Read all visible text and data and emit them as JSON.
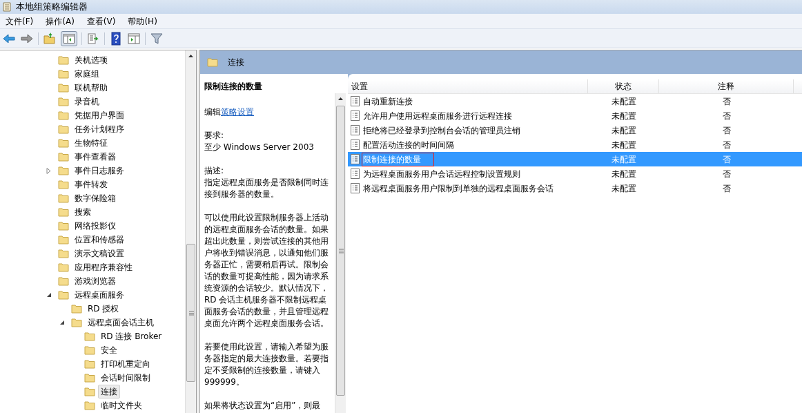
{
  "window": {
    "title": "本地组策略编辑器"
  },
  "menu": [
    "文件(F)",
    "操作(A)",
    "查看(V)",
    "帮助(H)"
  ],
  "tree": [
    {
      "label": "关机选项",
      "kind": "leaf",
      "selected": false
    },
    {
      "label": "家庭组",
      "kind": "leaf",
      "selected": false
    },
    {
      "label": "联机帮助",
      "kind": "leaf",
      "selected": false
    },
    {
      "label": "录音机",
      "kind": "leaf",
      "selected": false
    },
    {
      "label": "凭据用户界面",
      "kind": "leaf",
      "selected": false
    },
    {
      "label": "任务计划程序",
      "kind": "leaf",
      "selected": false
    },
    {
      "label": "生物特征",
      "kind": "leaf",
      "selected": false
    },
    {
      "label": "事件查看器",
      "kind": "leaf",
      "selected": false
    },
    {
      "label": "事件日志服务",
      "kind": "collapsed",
      "selected": false
    },
    {
      "label": "事件转发",
      "kind": "leaf",
      "selected": false
    },
    {
      "label": "数字保险箱",
      "kind": "leaf",
      "selected": false
    },
    {
      "label": "搜索",
      "kind": "leaf",
      "selected": false
    },
    {
      "label": "网络投影仪",
      "kind": "leaf",
      "selected": false
    },
    {
      "label": "位置和传感器",
      "kind": "leaf",
      "selected": false
    },
    {
      "label": "演示文稿设置",
      "kind": "leaf",
      "selected": false
    },
    {
      "label": "应用程序兼容性",
      "kind": "leaf",
      "selected": false
    },
    {
      "label": "游戏浏览器",
      "kind": "leaf",
      "selected": false
    },
    {
      "label": "远程桌面服务",
      "kind": "expanded",
      "selected": false,
      "children": [
        {
          "label": "RD 授权",
          "kind": "leaf",
          "selected": false
        },
        {
          "label": "远程桌面会话主机",
          "kind": "expanded",
          "selected": false,
          "children": [
            {
              "label": "RD 连接 Broker",
              "kind": "leaf",
              "selected": false
            },
            {
              "label": "安全",
              "kind": "leaf",
              "selected": false
            },
            {
              "label": "打印机重定向",
              "kind": "leaf",
              "selected": false
            },
            {
              "label": "会话时间限制",
              "kind": "leaf",
              "selected": false
            },
            {
              "label": "连接",
              "kind": "leaf",
              "selected": true
            },
            {
              "label": "临时文件夹",
              "kind": "leaf",
              "selected": false
            }
          ]
        }
      ]
    }
  ],
  "header": {
    "title": "连接"
  },
  "description": {
    "title": "限制连接的数量",
    "edit_prefix": "编辑",
    "edit_link": "策略设置",
    "requirements_label": "要求:",
    "requirements": "至少 Windows Server 2003",
    "description_label": "描述:",
    "paragraphs": [
      "指定远程桌面服务是否限制同时连接到服务器的数量。",
      "可以使用此设置限制服务器上活动的远程桌面服务会话的数量。如果超出此数量，则尝试连接的其他用户将收到错误消息，以通知他们服务器正忙，需要稍后再试。限制会话的数量可提高性能，因为请求系统资源的会话较少。默认情况下，RD 会话主机服务器不限制远程桌面服务会话的数量，并且管理远程桌面允许两个远程桌面服务会话。",
      "若要使用此设置，请输入希望为服务器指定的最大连接数量。若要指定不受限制的连接数量，请键入 999999。",
      "如果将状态设置为“启用”，则最"
    ]
  },
  "table": {
    "columns": [
      "设置",
      "状态",
      "注释"
    ],
    "rows": [
      {
        "setting": "自动重新连接",
        "state": "未配置",
        "comment": "否",
        "selected": false,
        "outlined": false
      },
      {
        "setting": "允许用户使用远程桌面服务进行远程连接",
        "state": "未配置",
        "comment": "否",
        "selected": false,
        "outlined": false
      },
      {
        "setting": "拒绝将已经登录到控制台会话的管理员注销",
        "state": "未配置",
        "comment": "否",
        "selected": false,
        "outlined": false
      },
      {
        "setting": "配置活动连接的时间间隔",
        "state": "未配置",
        "comment": "否",
        "selected": false,
        "outlined": false
      },
      {
        "setting": "限制连接的数量",
        "state": "未配置",
        "comment": "否",
        "selected": true,
        "outlined": true
      },
      {
        "setting": "为远程桌面服务用户会话远程控制设置规则",
        "state": "未配置",
        "comment": "否",
        "selected": false,
        "outlined": false
      },
      {
        "setting": "将远程桌面服务用户限制到单独的远程桌面服务会话",
        "state": "未配置",
        "comment": "否",
        "selected": false,
        "outlined": false
      }
    ]
  }
}
